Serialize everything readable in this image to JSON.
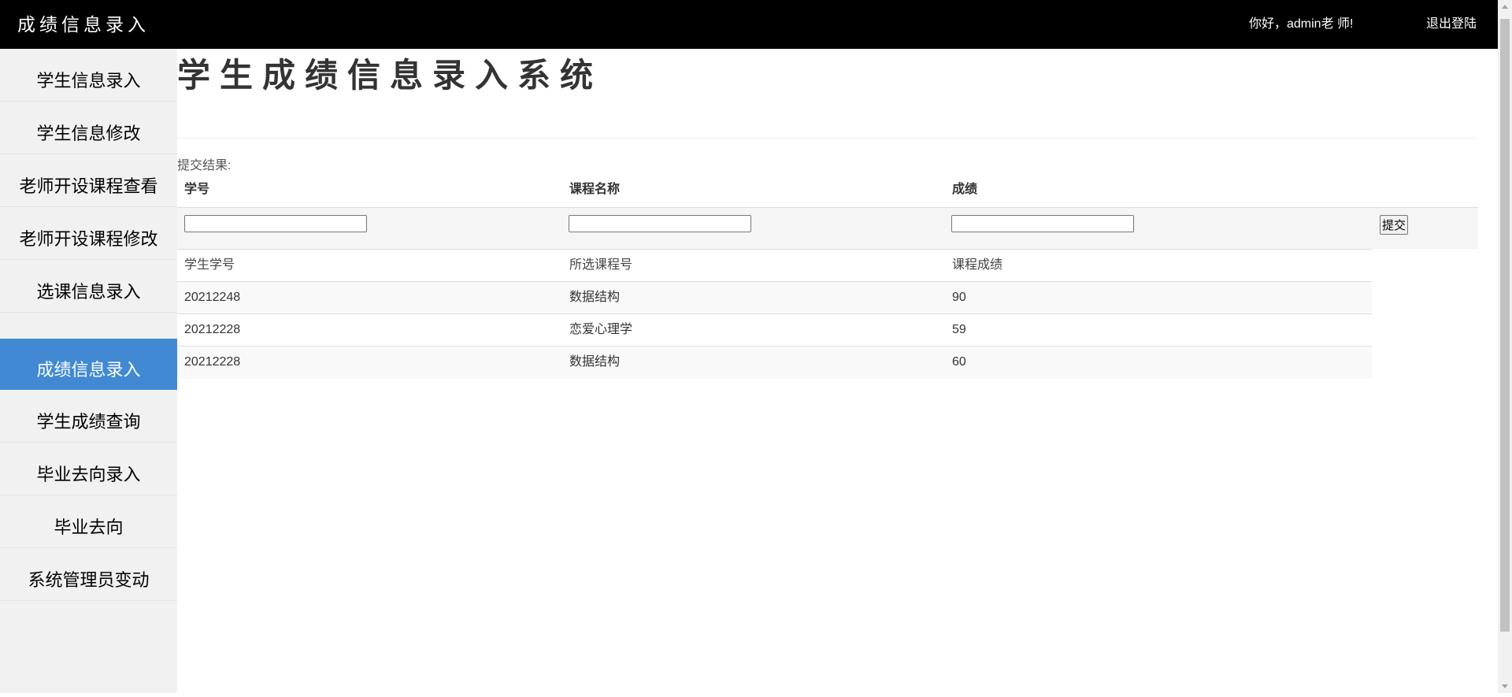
{
  "header": {
    "app_title": "成绩信息录入",
    "greeting": "你好，admin老 师!",
    "logout_label": "退出登陆"
  },
  "sidebar": {
    "items": [
      {
        "label": "学生信息录入"
      },
      {
        "label": "学生信息修改"
      },
      {
        "label": "老师开设课程查看"
      },
      {
        "label": "老师开设课程修改"
      },
      {
        "label": "选课信息录入"
      },
      {
        "label": "成绩信息录入",
        "active": true
      },
      {
        "label": "学生成绩查询"
      },
      {
        "label": "毕业去向录入"
      },
      {
        "label": "毕业去向"
      },
      {
        "label": "系统管理员变动"
      }
    ]
  },
  "main": {
    "heading": "学生成绩信息录入系统",
    "result_label": "提交结果:",
    "form": {
      "columns": [
        "学号",
        "课程名称",
        "成绩"
      ],
      "inputs": {
        "student_id": "",
        "course_name": "",
        "score": ""
      },
      "submit_label": "提交"
    },
    "results": {
      "columns": [
        "学生学号",
        "所选课程号",
        "课程成绩"
      ],
      "rows": [
        {
          "student_id": "20212248",
          "course": "数据结构",
          "score": "90"
        },
        {
          "student_id": "20212228",
          "course": "恋爱心理学",
          "score": "59"
        },
        {
          "student_id": "20212228",
          "course": "数据结构",
          "score": "60"
        }
      ]
    }
  },
  "icons": {
    "scroll_up": "triangle-up-icon",
    "scroll_down": "triangle-down-icon"
  },
  "colors": {
    "topbar_bg": "#000000",
    "sidebar_bg": "#f1f1f1",
    "active_item_bg": "#4189d2"
  }
}
